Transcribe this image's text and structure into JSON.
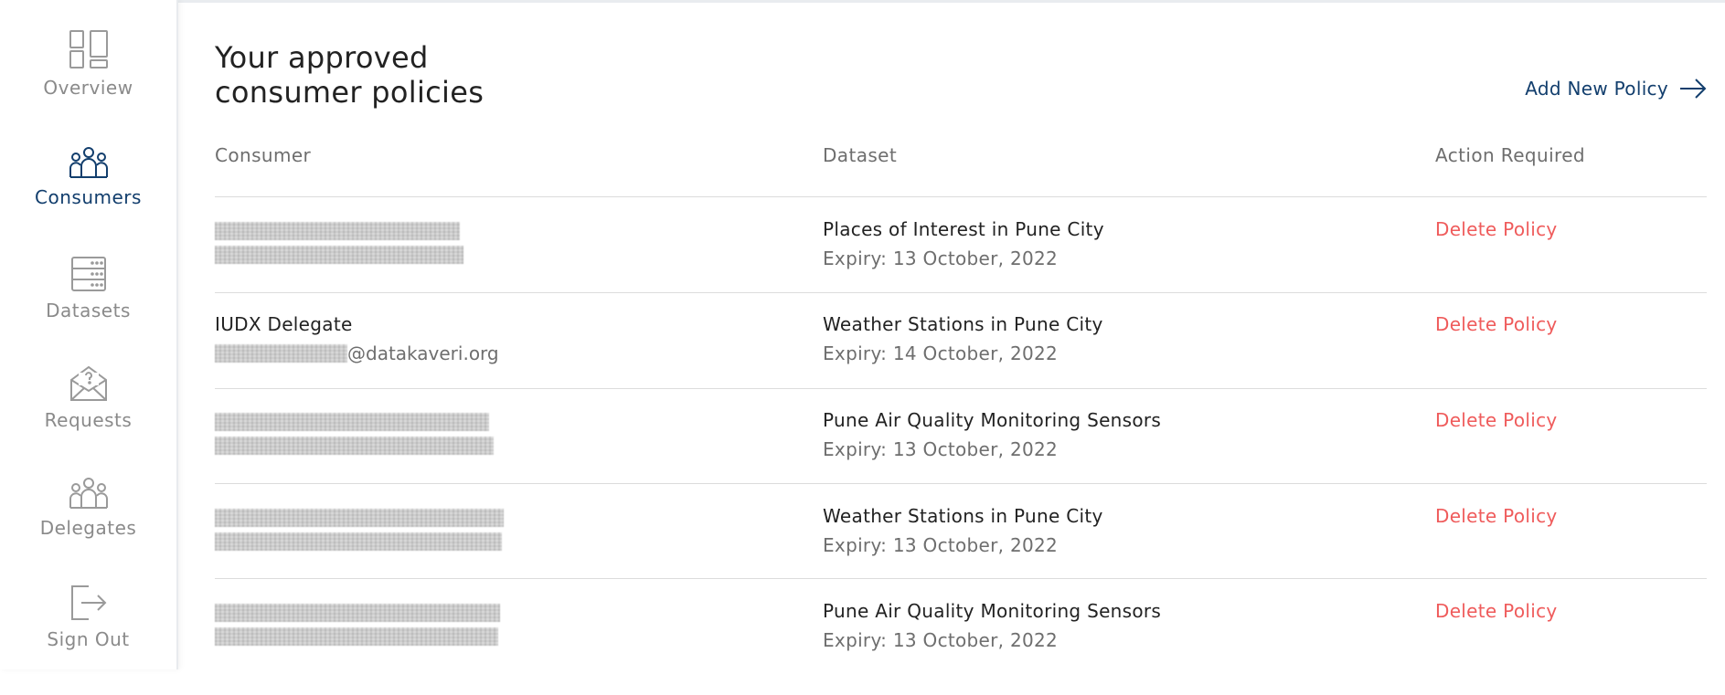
{
  "sidebar": {
    "items": [
      {
        "label": "Overview",
        "icon": "overview-icon",
        "active": false
      },
      {
        "label": "Consumers",
        "icon": "consumers-icon",
        "active": true
      },
      {
        "label": "Datasets",
        "icon": "datasets-icon",
        "active": false
      },
      {
        "label": "Requests",
        "icon": "requests-icon",
        "active": false
      },
      {
        "label": "Delegates",
        "icon": "delegates-icon",
        "active": false
      },
      {
        "label": "Sign Out",
        "icon": "sign-out-icon",
        "active": false
      }
    ]
  },
  "main": {
    "title_line1": "Your approved",
    "title_line2": "consumer policies",
    "add_policy_label": "Add New Policy",
    "columns": {
      "consumer": "Consumer",
      "dataset": "Dataset",
      "action": "Action Required"
    },
    "rows": [
      {
        "consumer_name": "",
        "consumer_email": "",
        "dataset": "Places of Interest in Pune City",
        "expiry": "Expiry: 13 October, 2022",
        "action": "Delete Policy"
      },
      {
        "consumer_name": "IUDX Delegate",
        "consumer_email": "@datakaveri.org",
        "dataset": "Weather Stations in Pune City",
        "expiry": "Expiry: 14 October, 2022",
        "action": "Delete Policy"
      },
      {
        "consumer_name": "",
        "consumer_email": "",
        "dataset": "Pune Air Quality Monitoring Sensors",
        "expiry": "Expiry: 13 October, 2022",
        "action": "Delete Policy"
      },
      {
        "consumer_name": "",
        "consumer_email": "",
        "dataset": "Weather Stations in Pune City",
        "expiry": "Expiry: 13 October, 2022",
        "action": "Delete Policy"
      },
      {
        "consumer_name": "",
        "consumer_email": "",
        "dataset": "Pune Air Quality Monitoring Sensors",
        "expiry": "Expiry: 13 October, 2022",
        "action": "Delete Policy"
      }
    ]
  },
  "colors": {
    "brand": "#123e6d",
    "danger": "#ef5b5b",
    "muted": "#8a8a8a"
  }
}
